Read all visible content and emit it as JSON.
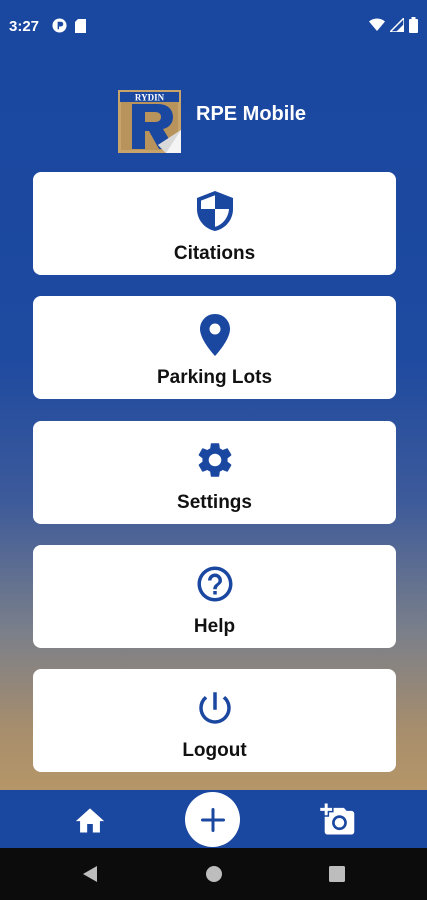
{
  "status_bar": {
    "time": "3:27",
    "left_icons": [
      "notification-app-icon",
      "sd-card-icon"
    ],
    "right_icons": [
      "wifi-icon",
      "cell-signal-icon",
      "battery-icon"
    ]
  },
  "header": {
    "logo_text": "RYDIN",
    "logo_letter": "R",
    "app_title": "RPE Mobile"
  },
  "menu": {
    "items": [
      {
        "label": "Citations",
        "icon": "shield-icon"
      },
      {
        "label": "Parking Lots",
        "icon": "location-pin-icon"
      },
      {
        "label": "Settings",
        "icon": "gear-icon"
      },
      {
        "label": "Help",
        "icon": "help-circle-icon"
      },
      {
        "label": "Logout",
        "icon": "power-icon"
      }
    ]
  },
  "bottom_nav": {
    "items": [
      "home-icon",
      "add-icon",
      "add-photo-icon"
    ]
  },
  "colors": {
    "primary": "#1a47a0",
    "icon_blue": "#1a47a0",
    "gradient_bottom": "#b59668",
    "card": "#ffffff"
  }
}
